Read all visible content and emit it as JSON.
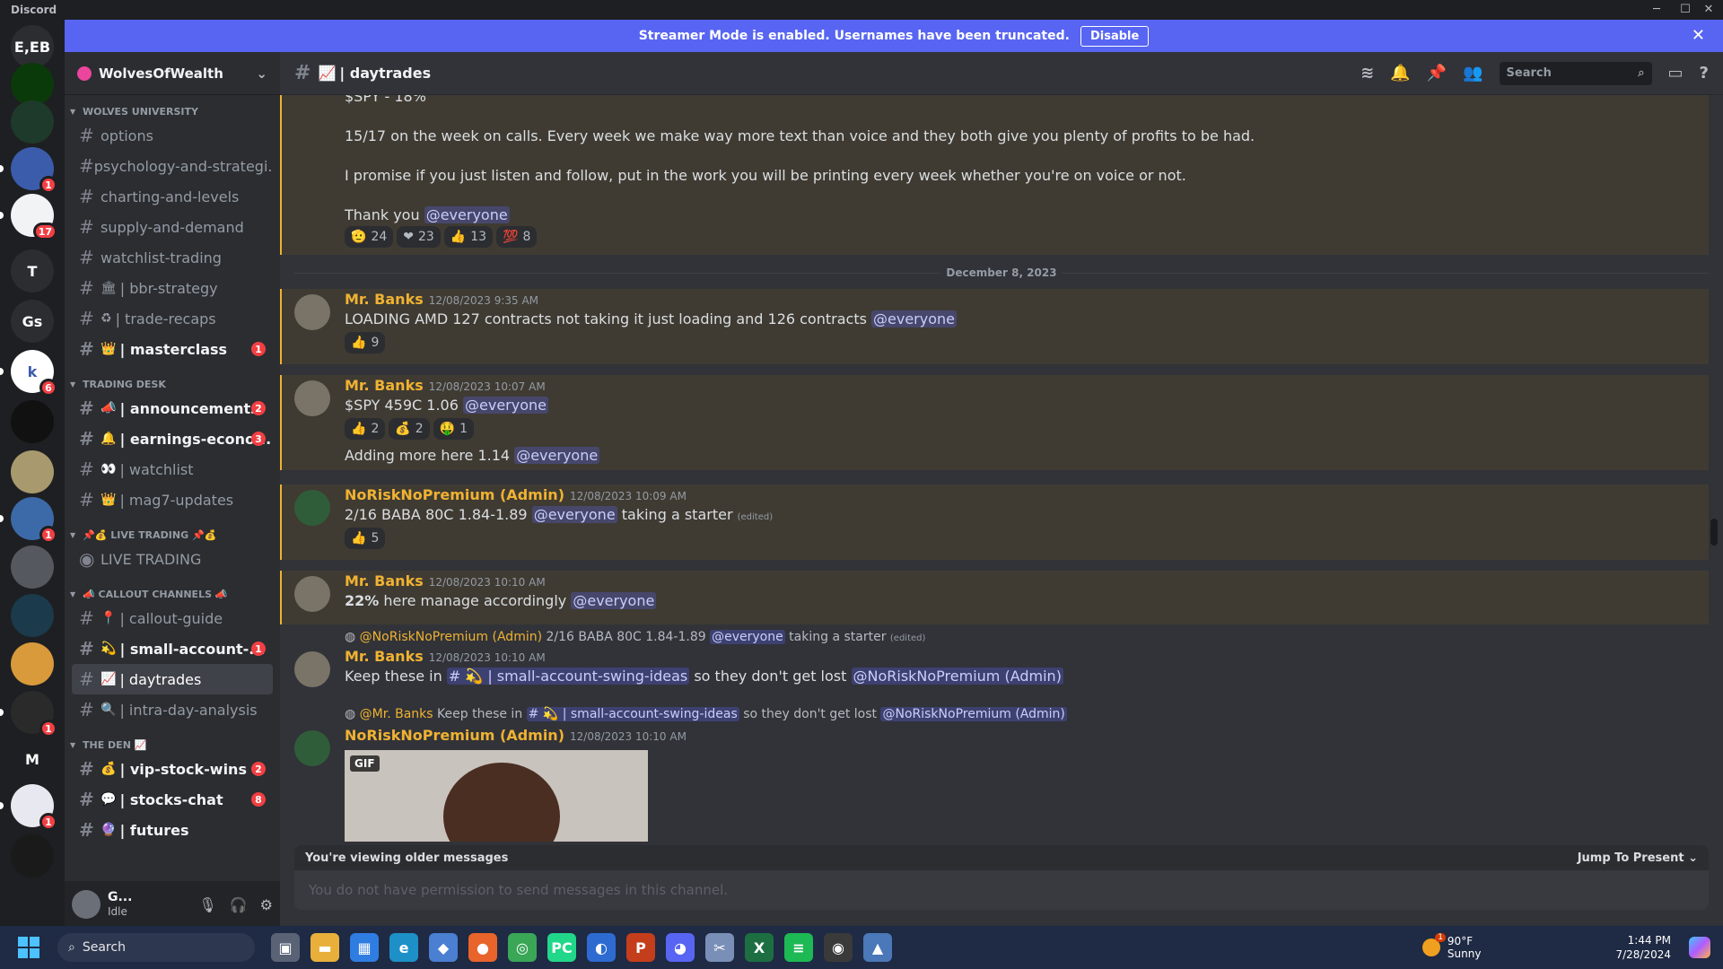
{
  "window": {
    "app_name": "Discord"
  },
  "banner": {
    "text": "Streamer Mode is enabled. Usernames have been truncated.",
    "disable_label": "Disable"
  },
  "guilds": [
    {
      "label": "E,EB",
      "color": "#2b2d31",
      "badge": ""
    },
    {
      "label": "",
      "color": "#0a3a0a",
      "badge": ""
    },
    {
      "label": "",
      "color": "#1e3a2a",
      "badge": ""
    },
    {
      "label": "",
      "color": "#3b5cab",
      "badge": "1"
    },
    {
      "label": "",
      "color": "#f2f3f5",
      "badge": "17"
    },
    {
      "label": "T",
      "color": "#2b2d31",
      "badge": ""
    },
    {
      "label": "Gs",
      "color": "#2b2d31",
      "badge": ""
    },
    {
      "label": "k",
      "color": "#ffffff",
      "badge": "6"
    },
    {
      "label": "",
      "color": "#111111",
      "badge": ""
    },
    {
      "label": "",
      "color": "#a89a6e",
      "badge": ""
    },
    {
      "label": "",
      "color": "#3c6aa8",
      "badge": "1"
    },
    {
      "label": "",
      "color": "#55585e",
      "badge": ""
    },
    {
      "label": "",
      "color": "#1b3a4b",
      "badge": ""
    },
    {
      "label": "",
      "color": "#d89a3b",
      "badge": ""
    },
    {
      "label": "",
      "color": "#2a2a2a",
      "badge": "1"
    },
    {
      "label": "M",
      "color": "#1e1f22",
      "badge": ""
    },
    {
      "label": "",
      "color": "#e8e8f0",
      "badge": "1"
    },
    {
      "label": "",
      "color": "#1a1a1a",
      "badge": ""
    }
  ],
  "server": {
    "name": "WolvesOfWealth"
  },
  "categories": [
    {
      "name": "WOLVES UNIVERSITY",
      "channels": [
        {
          "name": "options",
          "emoji": "",
          "badge": "",
          "unread": false,
          "active": false
        },
        {
          "name": "psychology-and-strategi...",
          "emoji": "",
          "badge": "",
          "unread": false,
          "active": false
        },
        {
          "name": "charting-and-levels",
          "emoji": "",
          "badge": "",
          "unread": false,
          "active": false
        },
        {
          "name": "supply-and-demand",
          "emoji": "",
          "badge": "",
          "unread": false,
          "active": false
        },
        {
          "name": "watchlist-trading",
          "emoji": "",
          "badge": "",
          "unread": false,
          "active": false
        },
        {
          "name": "| bbr-strategy",
          "emoji": "🏛",
          "badge": "",
          "unread": false,
          "active": false
        },
        {
          "name": "| trade-recaps",
          "emoji": "♻",
          "badge": "",
          "unread": false,
          "active": false
        },
        {
          "name": "| masterclass",
          "emoji": "👑",
          "badge": "1",
          "unread": true,
          "active": false
        }
      ]
    },
    {
      "name": "TRADING DESK",
      "channels": [
        {
          "name": "| announcements",
          "emoji": "📣",
          "badge": "2",
          "unread": true,
          "active": false
        },
        {
          "name": "| earnings-econo...",
          "emoji": "🔔",
          "badge": "3",
          "unread": true,
          "active": false
        },
        {
          "name": "| watchlist",
          "emoji": "👀",
          "badge": "",
          "unread": false,
          "active": false
        },
        {
          "name": "| mag7-updates",
          "emoji": "👑",
          "badge": "",
          "unread": false,
          "active": false
        }
      ]
    },
    {
      "name": "📌💰 LIVE TRADING 📌💰",
      "channels": [
        {
          "name": "LIVE TRADING",
          "emoji": "",
          "badge": "",
          "unread": false,
          "active": false,
          "voice": true
        }
      ]
    },
    {
      "name": "📣 CALLOUT CHANNELS 📣",
      "channels": [
        {
          "name": "| callout-guide",
          "emoji": "📍",
          "badge": "",
          "unread": false,
          "active": false
        },
        {
          "name": "| small-account-...",
          "emoji": "💫",
          "badge": "1",
          "unread": true,
          "active": false
        },
        {
          "name": "| daytrades",
          "emoji": "📈",
          "badge": "",
          "unread": false,
          "active": true
        },
        {
          "name": "| intra-day-analysis",
          "emoji": "🔍",
          "badge": "",
          "unread": false,
          "active": false
        }
      ]
    },
    {
      "name": "THE DEN 📈",
      "channels": [
        {
          "name": "| vip-stock-wins",
          "emoji": "💰",
          "badge": "2",
          "unread": true,
          "active": false
        },
        {
          "name": "| stocks-chat",
          "emoji": "💬",
          "badge": "8",
          "unread": true,
          "active": false
        },
        {
          "name": "| futures",
          "emoji": "🔮",
          "badge": "",
          "unread": true,
          "active": false
        }
      ]
    }
  ],
  "user": {
    "name": "G...",
    "status": "Idle"
  },
  "channel_header": {
    "name": "| daytrades",
    "emoji": "📈",
    "search_placeholder": "Search"
  },
  "messages": {
    "top_partial": "$SPY - 18%",
    "top_line1": "15/17 on the week on calls. Every week we make way more text than voice and they both give you plenty of profits to be had.",
    "top_line2": "I promise if you just listen and follow, put in the work you will be printing every week whether you're on voice or not.",
    "top_line3": "Thank you",
    "top_mention": "@everyone",
    "top_reactions": [
      {
        "emoji": "🫡",
        "count": "24"
      },
      {
        "emoji": "❤",
        "count": "23"
      },
      {
        "emoji": "👍",
        "count": "13"
      },
      {
        "emoji": "💯",
        "count": "8"
      }
    ],
    "date_divider": "December 8, 2023",
    "m1": {
      "author": "Mr. Banks",
      "time": "12/08/2023 9:35 AM",
      "text": "LOADING  AMD 127 contracts not taking it just loading and 126 contracts",
      "mention": "@everyone",
      "reactions": [
        {
          "emoji": "👍",
          "count": "9"
        }
      ]
    },
    "m2": {
      "author": "Mr. Banks",
      "time": "12/08/2023 10:07 AM",
      "text": "$SPY 459C 1.06",
      "mention": "@everyone",
      "reactions": [
        {
          "emoji": "👍",
          "count": "2"
        },
        {
          "emoji": "💰",
          "count": "2"
        },
        {
          "emoji": "🤑",
          "count": "1"
        }
      ],
      "text2": "Adding more here 1.14",
      "mention2": "@everyone"
    },
    "m3": {
      "author": "NoRiskNoPremium (Admin)",
      "time": "12/08/2023 10:09 AM",
      "text": "2/16 BABA 80C 1.84-1.89",
      "mention": "@everyone",
      "text_after": "taking a starter",
      "edited": "(edited)",
      "reactions": [
        {
          "emoji": "👍",
          "count": "5"
        }
      ]
    },
    "m4": {
      "author": "Mr. Banks",
      "time": "12/08/2023 10:10 AM",
      "bold": "22%",
      "text": "here manage accordingly",
      "mention": "@everyone"
    },
    "m5": {
      "reply_author": "@NoRiskNoPremium (Admin)",
      "reply_text": "2/16 BABA 80C 1.84-1.89",
      "reply_mention": "@everyone",
      "reply_after": "taking a starter",
      "reply_edited": "(edited)",
      "author": "Mr. Banks",
      "time": "12/08/2023 10:10 AM",
      "text": "Keep these in",
      "channel_link": "# 💫 | small-account-swing-ideas",
      "text_after": "so they don't get lost",
      "mention": "@NoRiskNoPremium (Admin)"
    },
    "m6": {
      "reply_author": "@Mr. Banks",
      "reply_text": "Keep these in",
      "reply_channel": "# 💫 | small-account-swing-ideas",
      "reply_after": "so they don't get lost",
      "reply_mention": "@NoRiskNoPremium (Admin)",
      "author": "NoRiskNoPremium (Admin)",
      "time": "12/08/2023 10:10 AM",
      "gif_label": "GIF"
    }
  },
  "older_bar": {
    "text": "You're viewing older messages",
    "jump": "Jump To Present"
  },
  "composer": {
    "placeholder": "You do not have permission to send messages in this channel."
  },
  "taskbar": {
    "search": "Search",
    "weather_temp": "90°F",
    "weather_desc": "Sunny",
    "time": "1:44 PM",
    "date": "7/28/2024",
    "weather_badge": "1"
  }
}
